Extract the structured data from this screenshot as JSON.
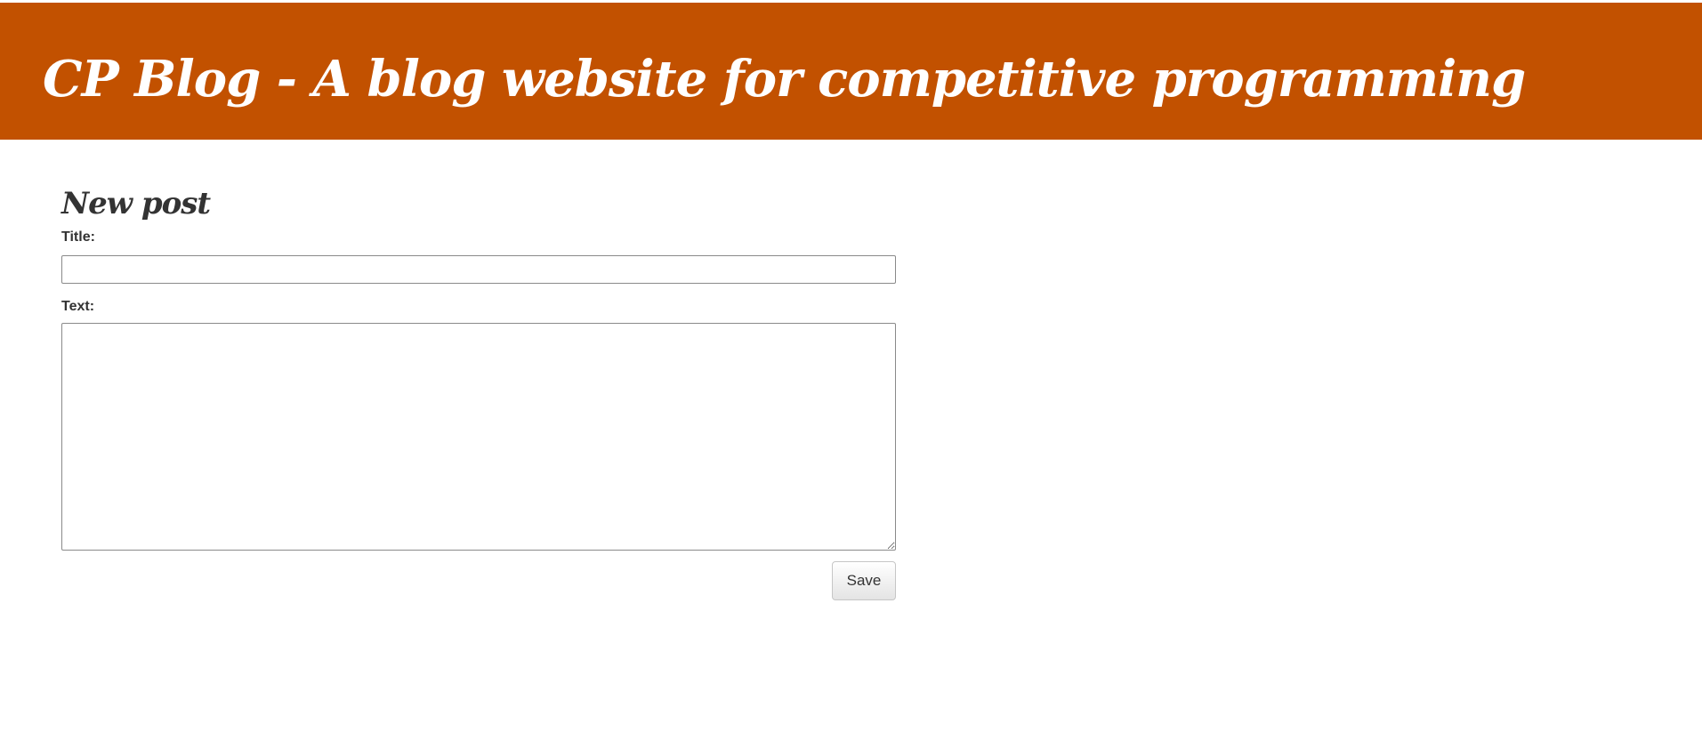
{
  "header": {
    "title": "CP Blog - A blog website for competitive programming"
  },
  "form": {
    "heading": "New post",
    "title_label": "Title:",
    "title_value": "",
    "text_label": "Text:",
    "text_value": "",
    "save_label": "Save"
  },
  "colors": {
    "header_background": "#c25100",
    "header_text": "#ffffff",
    "body_text": "#333333"
  }
}
